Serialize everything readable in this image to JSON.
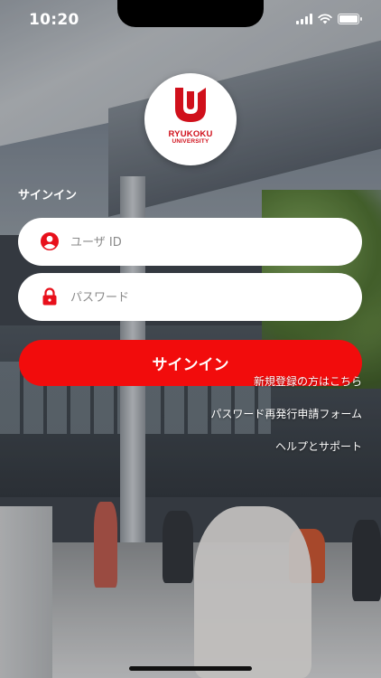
{
  "status_bar": {
    "time": "10:20"
  },
  "logo": {
    "line1": "RYUKOKU",
    "line2": "UNIVERSITY"
  },
  "signin": {
    "heading": "サインイン",
    "user_placeholder": "ユーザ ID",
    "password_placeholder": "パスワード",
    "button_label": "サインイン"
  },
  "links": {
    "register": "新規登録の方はこちら",
    "password_reset": "パスワード再発行申請フォーム",
    "help": "ヘルプとサポート"
  },
  "colors": {
    "brand_red": "#f20c0c",
    "logo_red": "#d0101b"
  },
  "icons": {
    "user": "person-circle-icon",
    "password": "lock-icon"
  }
}
